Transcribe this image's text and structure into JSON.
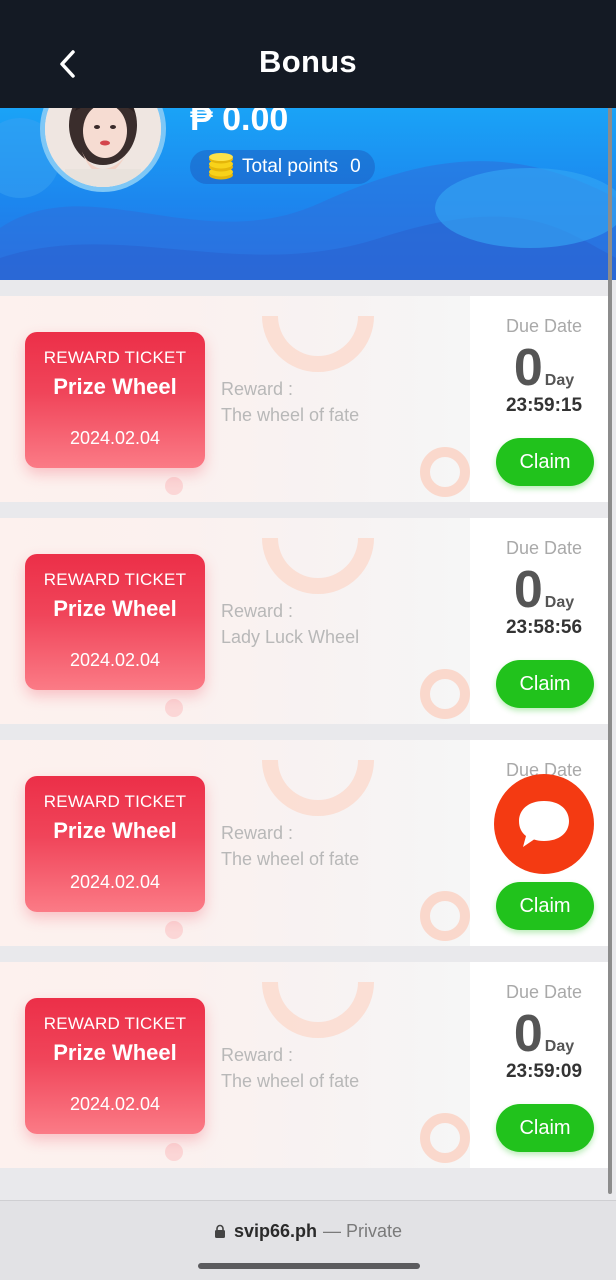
{
  "header": {
    "title": "Bonus",
    "back_icon": "chevron-left-icon"
  },
  "profile": {
    "balance": "₱ 0.00",
    "points_label": "Total points",
    "points_value": "0",
    "coin_icon": "coin-stack-icon"
  },
  "cards": [
    {
      "ticket_label": "REWARD TICKET",
      "ticket_name": "Prize Wheel",
      "ticket_date": "2024.02.04",
      "reward_label": "Reward :",
      "reward_value": "The wheel of fate",
      "due_label": "Due Date",
      "due_days": "0",
      "due_unit": "Day",
      "due_time": "23:59:15",
      "claim_label": "Claim"
    },
    {
      "ticket_label": "REWARD TICKET",
      "ticket_name": "Prize Wheel",
      "ticket_date": "2024.02.04",
      "reward_label": "Reward :",
      "reward_value": "Lady Luck Wheel",
      "due_label": "Due Date",
      "due_days": "0",
      "due_unit": "Day",
      "due_time": "23:58:56",
      "claim_label": "Claim"
    },
    {
      "ticket_label": "REWARD TICKET",
      "ticket_name": "Prize Wheel",
      "ticket_date": "2024.02.04",
      "reward_label": "Reward :",
      "reward_value": "The wheel of fate",
      "due_label": "Due Date",
      "due_days": "",
      "due_unit": "",
      "due_time": "",
      "claim_label": "Claim"
    },
    {
      "ticket_label": "REWARD TICKET",
      "ticket_name": "Prize Wheel",
      "ticket_date": "2024.02.04",
      "reward_label": "Reward :",
      "reward_value": "The wheel of fate",
      "due_label": "Due Date",
      "due_days": "0",
      "due_unit": "Day",
      "due_time": "23:59:09",
      "claim_label": "Claim"
    }
  ],
  "browser": {
    "domain": "svip66.ph",
    "suffix": "— Private",
    "lock_icon": "lock-icon"
  },
  "chat_icon": "chat-bubble-icon",
  "colors": {
    "accent_green": "#21c21c",
    "ticket_red": "#ec2f48",
    "header_blue": "#1c86ee",
    "chat_red": "#f43a12"
  }
}
